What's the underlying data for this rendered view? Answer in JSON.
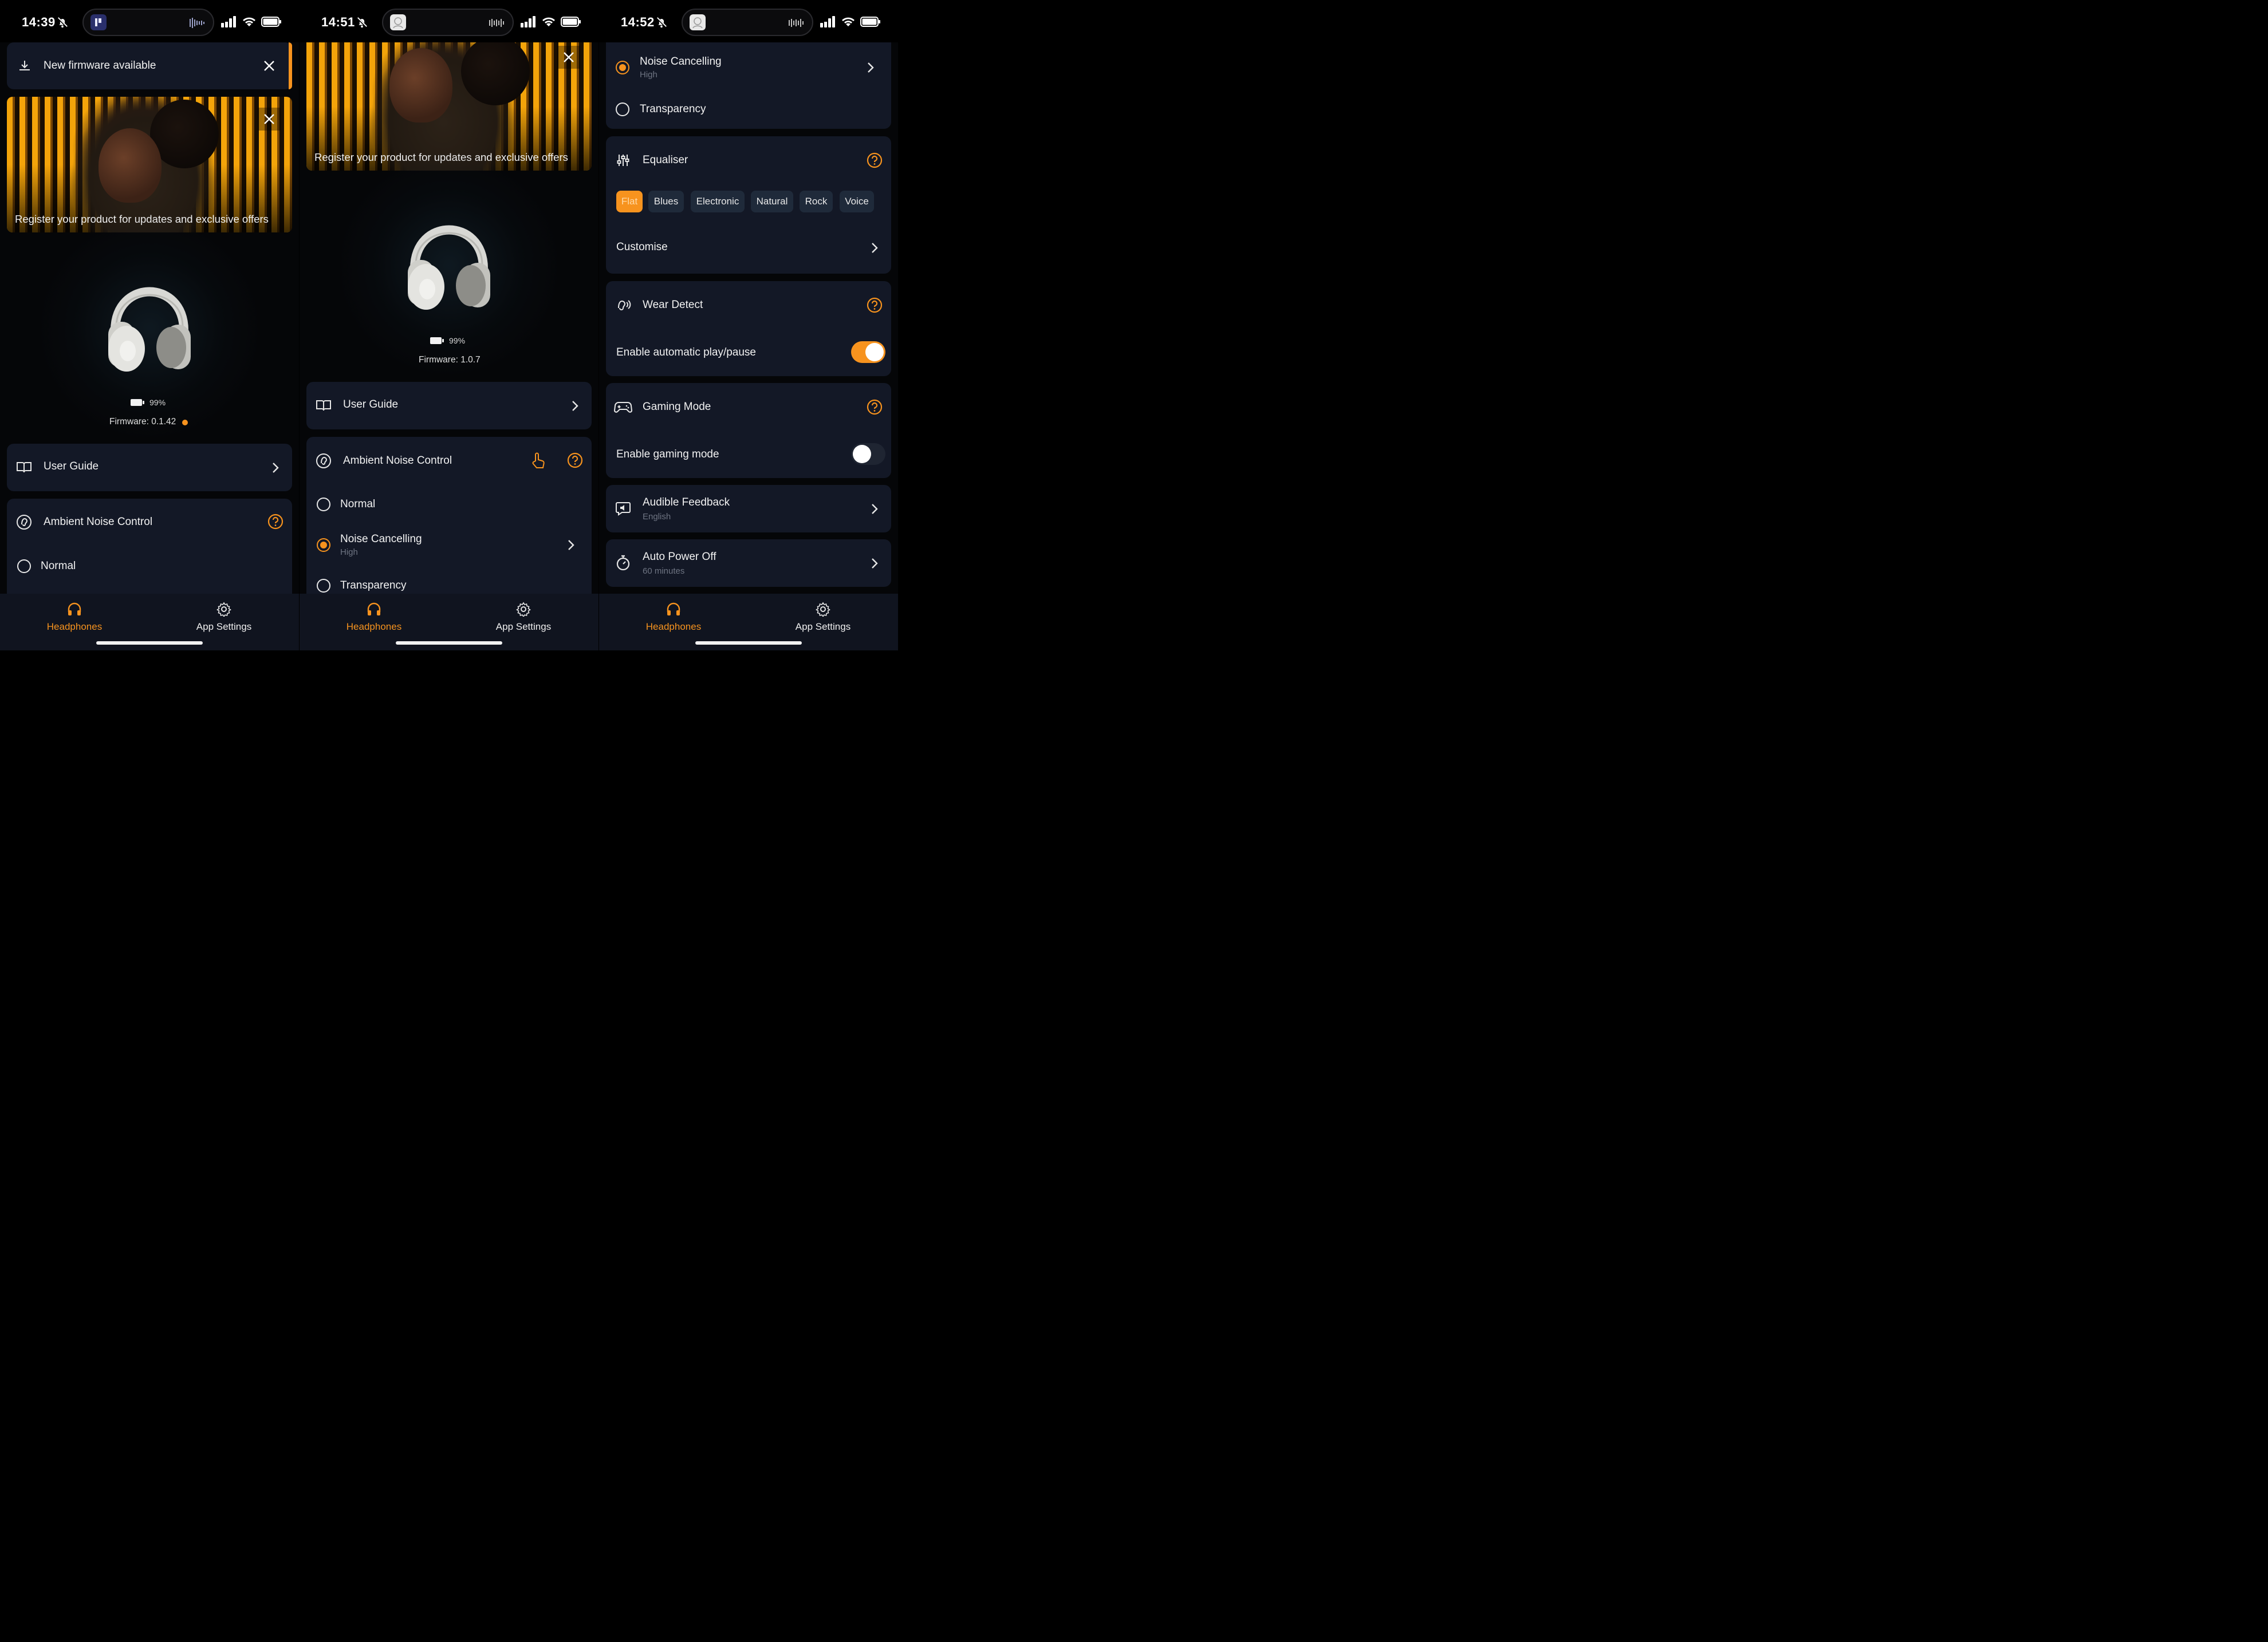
{
  "colors": {
    "accent": "#f7931e",
    "card": "#131826",
    "background": "#050608",
    "tabbar": "#10141f"
  },
  "screens": [
    {
      "status": {
        "time": "14:39"
      },
      "firmware_banner": {
        "label": "New firmware available"
      },
      "promo": {
        "text": "Register your product for updates and exclusive offers"
      },
      "device": {
        "battery": "99%",
        "firmware": "Firmware: 0.1.42",
        "update_dot": true
      },
      "user_guide": {
        "label": "User Guide"
      },
      "anc": {
        "title": "Ambient Noise Control",
        "options": [
          {
            "label": "Normal"
          }
        ]
      },
      "tabs": [
        {
          "label": "Headphones",
          "active": true
        },
        {
          "label": "App Settings",
          "active": false
        }
      ]
    },
    {
      "status": {
        "time": "14:51"
      },
      "promo": {
        "text": "Register your product for updates and exclusive offers"
      },
      "device": {
        "battery": "99%",
        "firmware": "Firmware: 1.0.7"
      },
      "user_guide": {
        "label": "User Guide"
      },
      "anc": {
        "title": "Ambient Noise Control",
        "options": [
          {
            "label": "Normal",
            "selected": false
          },
          {
            "label": "Noise Cancelling",
            "sub": "High",
            "selected": true
          },
          {
            "label": "Transparency",
            "selected": false
          }
        ]
      },
      "tabs": [
        {
          "label": "Headphones",
          "active": true
        },
        {
          "label": "App Settings",
          "active": false
        }
      ]
    },
    {
      "status": {
        "time": "14:52"
      },
      "anc_tail": {
        "options": [
          {
            "label": "Noise Cancelling",
            "sub": "High",
            "selected": true
          },
          {
            "label": "Transparency",
            "selected": false
          }
        ]
      },
      "equaliser": {
        "title": "Equaliser",
        "presets": [
          "Flat",
          "Blues",
          "Electronic",
          "Natural",
          "Rock",
          "Voice"
        ],
        "selected": "Flat",
        "customise": "Customise"
      },
      "wear_detect": {
        "title": "Wear Detect",
        "toggle_label": "Enable automatic play/pause",
        "enabled": true
      },
      "gaming": {
        "title": "Gaming Mode",
        "toggle_label": "Enable gaming mode",
        "enabled": false
      },
      "audible_feedback": {
        "title": "Audible Feedback",
        "sub": "English"
      },
      "auto_power_off": {
        "title": "Auto Power Off",
        "sub": "60 minutes"
      },
      "tabs": [
        {
          "label": "Headphones",
          "active": true
        },
        {
          "label": "App Settings",
          "active": false
        }
      ]
    }
  ]
}
